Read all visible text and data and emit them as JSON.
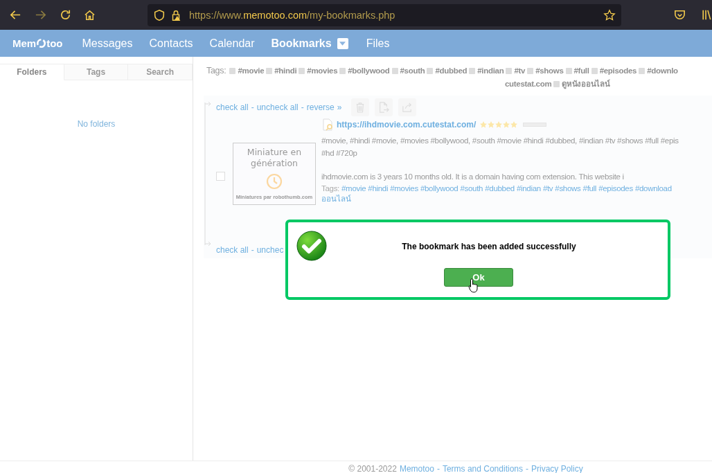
{
  "browser": {
    "url_parts": [
      "https://www.",
      "memotoo.com",
      "/my-bookmarks.php"
    ]
  },
  "nav": {
    "logo_parts": [
      "Mem",
      "too"
    ],
    "items": [
      {
        "label": "Messages",
        "selected": false,
        "dropdown": false
      },
      {
        "label": "Contacts",
        "selected": false,
        "dropdown": false
      },
      {
        "label": "Calendar",
        "selected": false,
        "dropdown": false
      },
      {
        "label": "Bookmarks",
        "selected": true,
        "dropdown": true
      },
      {
        "label": "Files",
        "selected": false,
        "dropdown": false
      }
    ]
  },
  "sidebar": {
    "tabs": [
      {
        "label": "Folders",
        "selected": true
      },
      {
        "label": "Tags",
        "selected": false
      },
      {
        "label": "Search",
        "selected": false
      }
    ],
    "empty_text": "No folders"
  },
  "tag_filter": {
    "label": "Tags:",
    "tags": [
      "#movie",
      "#hindi",
      "#movies",
      "#bollywood",
      "#south",
      "#dubbed",
      "#indian",
      "#tv",
      "#shows",
      "#full",
      "#episodes",
      "#downlo"
    ],
    "tags_line_2": [
      "cutestat.com",
      "ดูหนังออนไลน์"
    ]
  },
  "toolbar_top": {
    "links": [
      "check all",
      "uncheck all",
      "reverse"
    ],
    "separator": "-",
    "more": "»"
  },
  "bookmark": {
    "checked": false,
    "thumbnail": {
      "title": "Miniature en génération",
      "credit": "Miniatures par robothumb.com"
    },
    "url": "https://ihdmovie.com.cutestat.com/",
    "stars": 5,
    "description_lines": [
      "#movie, #hindi #movie, #movies #bollywood, #south #movie #hindi #dubbed, #indian #tv #shows #full #epis",
      "#hd #720p"
    ],
    "summary": "ihdmovie.com is 3 years 10 months old. It is a domain having com extension. This website i",
    "tags_label": "Tags:",
    "tags": [
      "#movie",
      "#hindi",
      "#movies",
      "#bollywood",
      "#south",
      "#dubbed",
      "#indian",
      "#tv",
      "#shows",
      "#full",
      "#episodes",
      "#download"
    ],
    "tags_line_2": "ออนไลน์"
  },
  "toolbar_bottom": {
    "links": [
      "check all",
      "unchec"
    ],
    "separator": "-"
  },
  "dialog": {
    "message": "The bookmark has been added successfully",
    "button": "Ok"
  },
  "footer": {
    "copyright": "© 2001-2022",
    "links": [
      "Memotoo",
      "Terms and Conditions",
      "Privacy Policy"
    ],
    "separator": "-"
  }
}
